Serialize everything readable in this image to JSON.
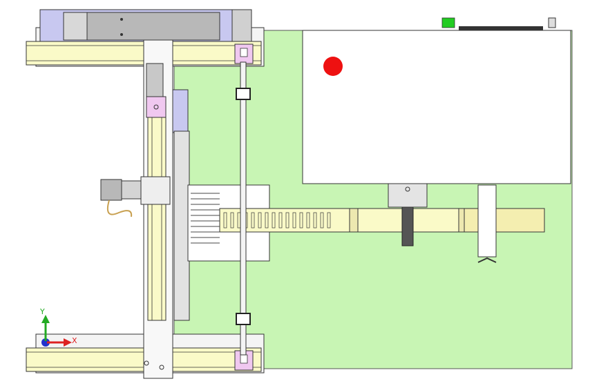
{
  "axis_triad": {
    "y_label": "Y",
    "x_label": "X",
    "y_color": "#22aa22",
    "x_color": "#dd2222",
    "z_color": "#2233cc"
  },
  "colors": {
    "base_plate": "#c8f5b4",
    "rail": "#fafac8",
    "panel_gray": "#c8c8c8",
    "panel_white": "#ffffff",
    "motor_blue": "#c8c8f0",
    "magenta_block": "#f0c8f0",
    "indicator_red": "#ee1111",
    "indicator_green": "#22cc22",
    "outline": "#222222"
  }
}
